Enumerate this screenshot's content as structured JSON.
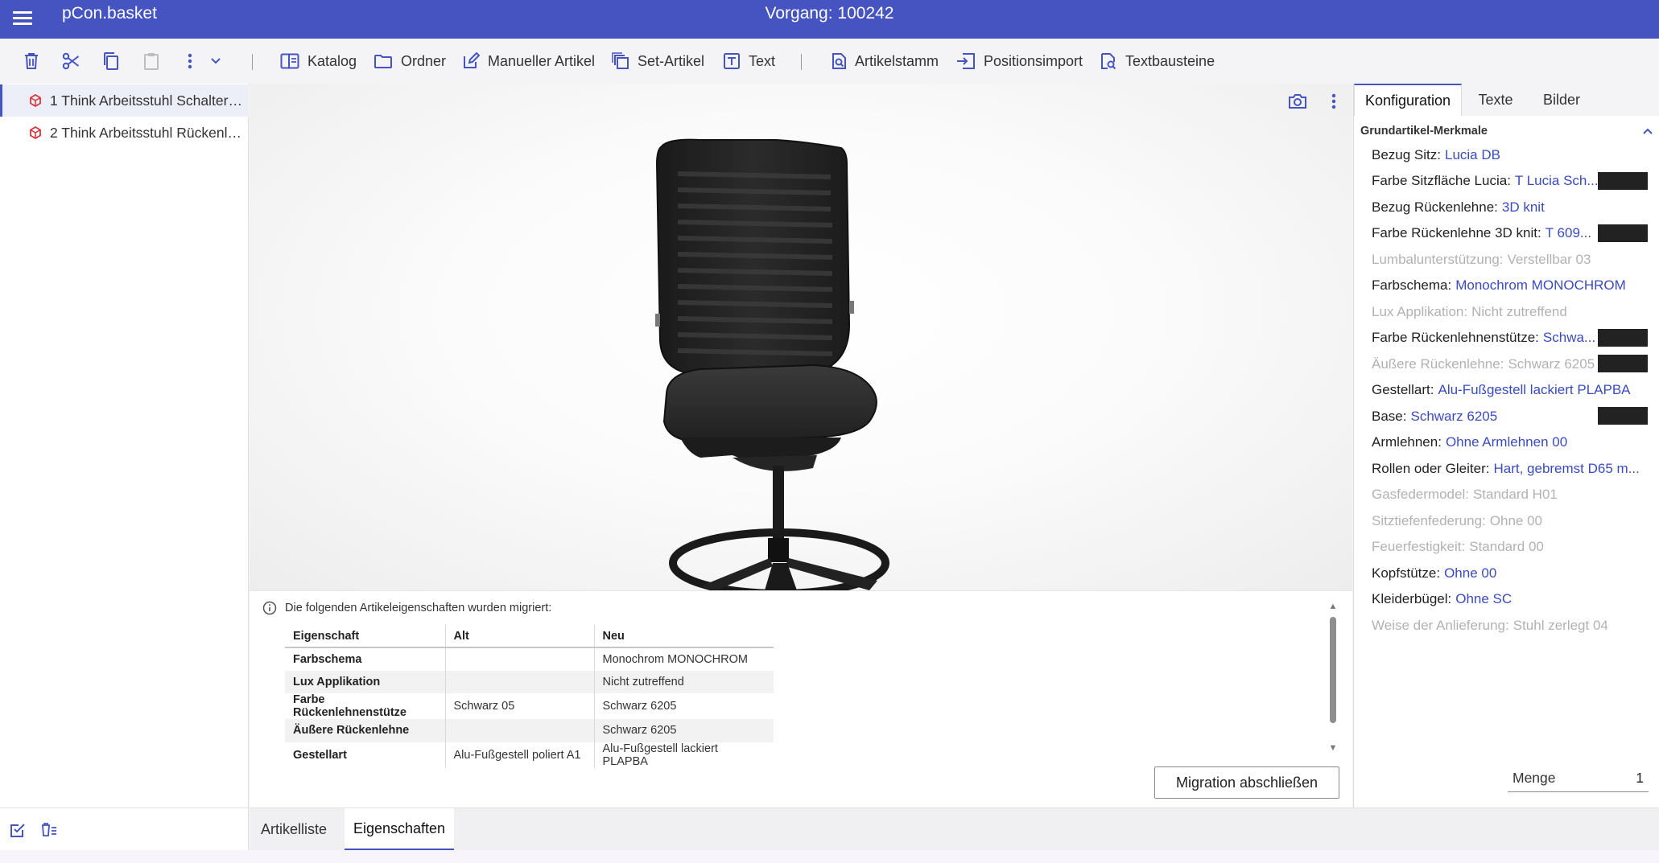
{
  "app": {
    "title": "pCon.basket",
    "vorgang": "Vorgang: 100242"
  },
  "toolbar": {
    "katalog": "Katalog",
    "ordner": "Ordner",
    "manueller_artikel": "Manueller Artikel",
    "set_artikel": "Set-Artikel",
    "text": "Text",
    "artikelstamm": "Artikelstamm",
    "positionsimport": "Positionsimport",
    "textbausteine": "Textbausteine"
  },
  "tree": [
    {
      "label": "1 Think Arbeitsstuhl Schalterst..."
    },
    {
      "label": "2 Think Arbeitsstuhl Rückenle..."
    }
  ],
  "migration": {
    "info": "Die folgenden Artikeleigenschaften wurden migriert:",
    "headers": {
      "eigenschaft": "Eigenschaft",
      "alt": "Alt",
      "neu": "Neu"
    },
    "rows": [
      {
        "eigenschaft": "Farbschema",
        "alt": "",
        "neu": "Monochrom MONOCHROM"
      },
      {
        "eigenschaft": "Lux Applikation",
        "alt": "",
        "neu": "Nicht zutreffend"
      },
      {
        "eigenschaft": "Farbe Rückenlehnenstütze",
        "alt": "Schwarz 05",
        "neu": "Schwarz 6205"
      },
      {
        "eigenschaft": "Äußere Rückenlehne",
        "alt": "",
        "neu": "Schwarz 6205"
      },
      {
        "eigenschaft": "Gestellart",
        "alt": "Alu-Fußgestell poliert A1",
        "neu": "Alu-Fußgestell lackiert PLAPBA"
      }
    ],
    "button": "Migration abschließen"
  },
  "right_panel": {
    "tabs": {
      "konfiguration": "Konfiguration",
      "texte": "Texte",
      "bilder": "Bilder"
    },
    "section": "Grundartikel-Merkmale",
    "props": [
      {
        "label": "Bezug Sitz:",
        "value": "Lucia DB"
      },
      {
        "label": "Farbe Sitzfläche Lucia:",
        "value": "T Lucia Sch..."
      },
      {
        "label": "Bezug Rückenlehne:",
        "value": "3D knit"
      },
      {
        "label": "Farbe Rückenlehne 3D knit:",
        "value": "T 609..."
      },
      {
        "label": "Lumbalunterstützung:",
        "value": "Verstellbar 03"
      },
      {
        "label": "Farbschema:",
        "value": "Monochrom MONOCHROM"
      },
      {
        "label": "Lux Applikation:",
        "value": "Nicht zutreffend"
      },
      {
        "label": "Farbe Rückenlehnenstütze:",
        "value": "Schwa..."
      },
      {
        "label": "Äußere Rückenlehne:",
        "value": "Schwarz 6205"
      },
      {
        "label": "Gestellart:",
        "value": "Alu-Fußgestell lackiert PLAPBA"
      },
      {
        "label": "Base:",
        "value": "Schwarz 6205"
      },
      {
        "label": "Armlehnen:",
        "value": "Ohne Armlehnen 00"
      },
      {
        "label": "Rollen oder Gleiter:",
        "value": "Hart, gebremst D65 m..."
      },
      {
        "label": "Gasfedermodel:",
        "value": "Standard H01"
      },
      {
        "label": "Sitztiefenfederung:",
        "value": "Ohne 00"
      },
      {
        "label": "Feuerfestigkeit:",
        "value": "Standard 00"
      },
      {
        "label": "Kopfstütze:",
        "value": "Ohne 00"
      },
      {
        "label": "Kleiderbügel:",
        "value": "Ohne SC"
      },
      {
        "label": "Weise der Anlieferung:",
        "value": "Stuhl zerlegt 04"
      }
    ],
    "menge_label": "Menge",
    "menge_value": "1"
  },
  "bottom_tabs": {
    "artikelliste": "Artikelliste",
    "eigenschaften": "Eigenschaften"
  },
  "colors": {
    "header": "#4554c0",
    "accent": "#3a4bc0",
    "swatch": "#222222"
  }
}
